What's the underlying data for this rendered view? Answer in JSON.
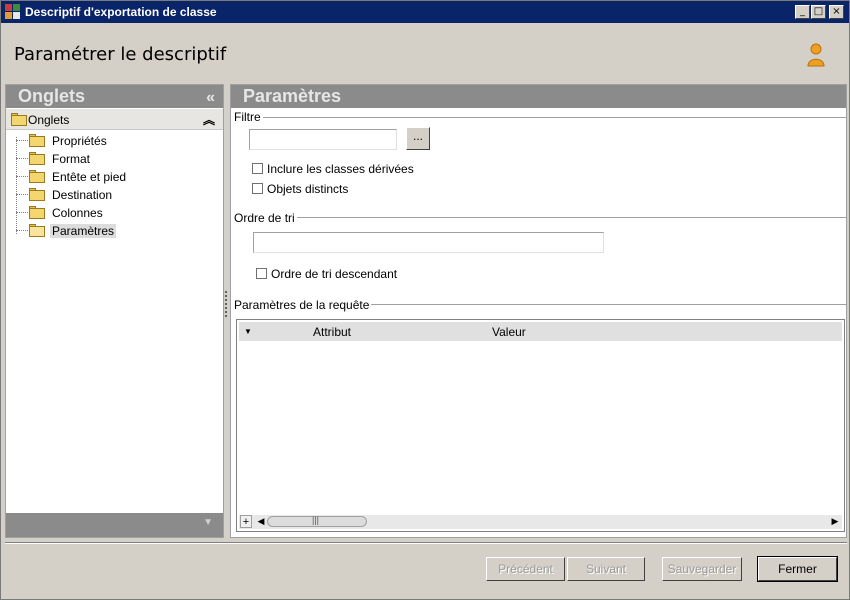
{
  "window": {
    "title": "Descriptif d'exportation de classe",
    "controls": {
      "minimize": "_",
      "maximize": "□",
      "close": "×"
    }
  },
  "header": {
    "title": "Paramétrer le descriptif",
    "user_icon": "user-icon"
  },
  "left": {
    "heading": "Onglets",
    "collapse": "«",
    "root_label": "Onglets",
    "root_chevron": "⌃",
    "items": [
      {
        "label": "Propriétés"
      },
      {
        "label": "Format"
      },
      {
        "label": "Entête et pied"
      },
      {
        "label": "Destination"
      },
      {
        "label": "Colonnes"
      },
      {
        "label": "Paramètres",
        "selected": true
      }
    ],
    "footer_arrow": "▼"
  },
  "right": {
    "heading": "Paramètres",
    "filtre": {
      "label": "Filtre",
      "value": "",
      "browse": "...",
      "inclure": {
        "label": "Inclure les classes dérivées",
        "checked": false
      },
      "distincts": {
        "label": "Objets distincts",
        "checked": false
      }
    },
    "tri": {
      "label": "Ordre de tri",
      "value": "",
      "descendant": {
        "label": "Ordre de tri descendant",
        "checked": false
      }
    },
    "requete": {
      "label": "Paramètres de la requête",
      "columns": [
        "Attribut",
        "Valeur"
      ],
      "sort_glyph": "▼",
      "add": "+",
      "scroll_left": "◀",
      "scroll_right": "▶"
    }
  },
  "buttons": {
    "precedent": "Précédent",
    "suivant": "Suivant",
    "sauvegarder": "Sauvegarder",
    "fermer": "Fermer"
  },
  "colors": {
    "titlebar": "#0a246a",
    "panel_header": "#8b8b8b",
    "window_bg": "#d4d0c8"
  }
}
